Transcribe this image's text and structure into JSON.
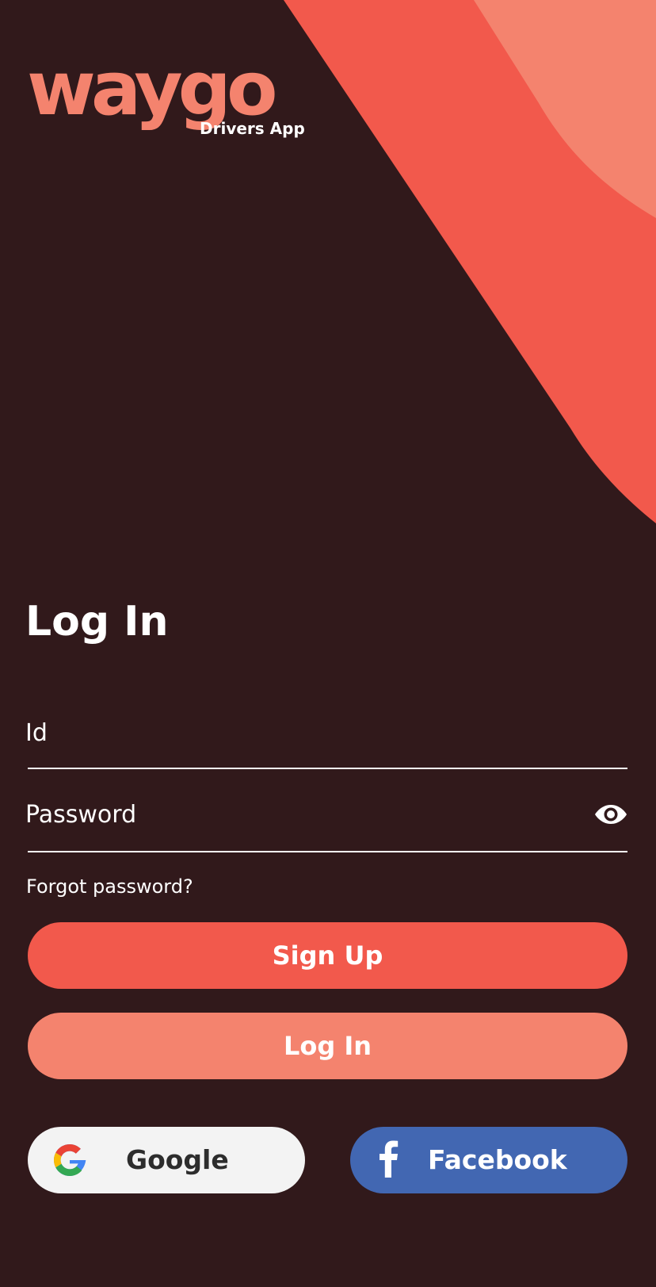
{
  "brand": {
    "name": "waygo",
    "subtitle": "Drivers App"
  },
  "login": {
    "title": "Log In",
    "id_placeholder": "Id",
    "password_placeholder": "Password",
    "forgot_label": "Forgot password?",
    "signup_label": "Sign Up",
    "login_label": "Log In",
    "google_label": "Google",
    "facebook_label": "Facebook"
  },
  "icons": {
    "password_toggle": "eye-icon",
    "google": "google-icon",
    "facebook": "facebook-icon"
  },
  "colors": {
    "background": "#31191b",
    "primary": "#f2594c",
    "secondary": "#f4836e",
    "google_bg": "#f3f3f3",
    "facebook_bg": "#4267b2"
  }
}
